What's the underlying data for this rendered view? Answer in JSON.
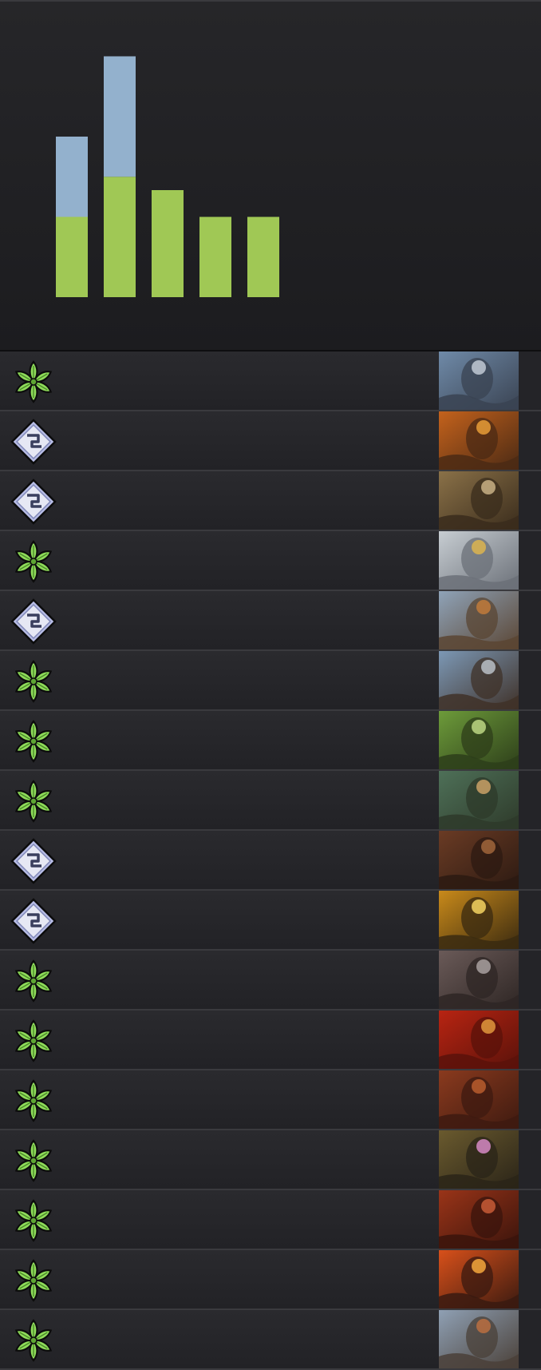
{
  "chart_data": {
    "type": "bar",
    "stacked": true,
    "categories": [
      "",
      "",
      "",
      "",
      ""
    ],
    "series": [
      {
        "color": "#a0c855",
        "values": [
          3,
          4.5,
          4,
          3,
          3
        ]
      },
      {
        "color": "#93b1cd",
        "values": [
          3,
          4.5,
          0,
          0,
          0
        ]
      }
    ],
    "grid": false,
    "legend": "none"
  },
  "theme": {
    "nature_faction_color": "#8fdc5a",
    "neutral_faction_color": "#b8bde6",
    "row_divider": "#3a3a3e"
  },
  "cards": [
    {
      "faction_icon": "nature-leaf-icon",
      "art": {
        "name": "card-art-rock-giant-climber",
        "colors": [
          "#6f8aa8",
          "#3a4352",
          "#c9d2dc"
        ]
      }
    },
    {
      "faction_icon": "neutral-diamond-icon",
      "art": {
        "name": "card-art-armored-warrior-sunset",
        "colors": [
          "#c4621c",
          "#4b2a14",
          "#f0a43a"
        ]
      }
    },
    {
      "faction_icon": "neutral-diamond-icon",
      "art": {
        "name": "card-art-woman-warrior",
        "colors": [
          "#8a7148",
          "#3a2c1c",
          "#d1b98c"
        ]
      }
    },
    {
      "faction_icon": "nature-leaf-icon",
      "art": {
        "name": "card-art-eagle-eye",
        "colors": [
          "#c7cdd2",
          "#6b7078",
          "#e2b84b"
        ]
      }
    },
    {
      "faction_icon": "neutral-diamond-icon",
      "art": {
        "name": "card-art-axe-brawler",
        "colors": [
          "#8fa3b8",
          "#5a4533",
          "#c77d3a"
        ]
      }
    },
    {
      "faction_icon": "nature-leaf-icon",
      "art": {
        "name": "card-art-shouting-swordsman",
        "colors": [
          "#7c98b5",
          "#3f3128",
          "#c0c8d0"
        ]
      }
    },
    {
      "faction_icon": "nature-leaf-icon",
      "art": {
        "name": "card-art-deer-silhouette-hunter",
        "colors": [
          "#6d9b3a",
          "#2d3e1a",
          "#c5e08a"
        ]
      }
    },
    {
      "faction_icon": "nature-leaf-icon",
      "art": {
        "name": "card-art-cat-folk-archers",
        "colors": [
          "#4e7058",
          "#2e3a2a",
          "#d3a66a"
        ]
      }
    },
    {
      "faction_icon": "neutral-diamond-icon",
      "art": {
        "name": "card-art-hooded-dwarf",
        "colors": [
          "#6a3b24",
          "#2c1a12",
          "#a86a3d"
        ]
      }
    },
    {
      "faction_icon": "neutral-diamond-icon",
      "art": {
        "name": "card-art-glowing-mage",
        "colors": [
          "#c98a1a",
          "#3a2a10",
          "#ffdd66"
        ]
      }
    },
    {
      "faction_icon": "nature-leaf-icon",
      "art": {
        "name": "card-art-dark-knight-battle",
        "colors": [
          "#6a5a58",
          "#2e2624",
          "#b0a8a8"
        ]
      }
    },
    {
      "faction_icon": "nature-leaf-icon",
      "art": {
        "name": "card-art-fire-charge",
        "colors": [
          "#b82412",
          "#5a120a",
          "#e8a040"
        ]
      }
    },
    {
      "faction_icon": "nature-leaf-icon",
      "art": {
        "name": "card-art-red-brute",
        "colors": [
          "#8a3a1e",
          "#3e1a10",
          "#c06030"
        ]
      }
    },
    {
      "faction_icon": "nature-leaf-icon",
      "art": {
        "name": "card-art-skull-flower",
        "colors": [
          "#6a5a2e",
          "#2a2418",
          "#e090d0"
        ]
      }
    },
    {
      "faction_icon": "nature-leaf-icon",
      "art": {
        "name": "card-art-bearded-fire-giant",
        "colors": [
          "#9a3418",
          "#3a140c",
          "#d0603a"
        ]
      }
    },
    {
      "faction_icon": "nature-leaf-icon",
      "art": {
        "name": "card-art-molten-fire",
        "colors": [
          "#d8501a",
          "#3a1a10",
          "#ffb040"
        ]
      }
    },
    {
      "faction_icon": "nature-leaf-icon",
      "art": {
        "name": "card-art-horned-viking",
        "colors": [
          "#8fa0b4",
          "#4a4038",
          "#c07040"
        ]
      }
    }
  ]
}
